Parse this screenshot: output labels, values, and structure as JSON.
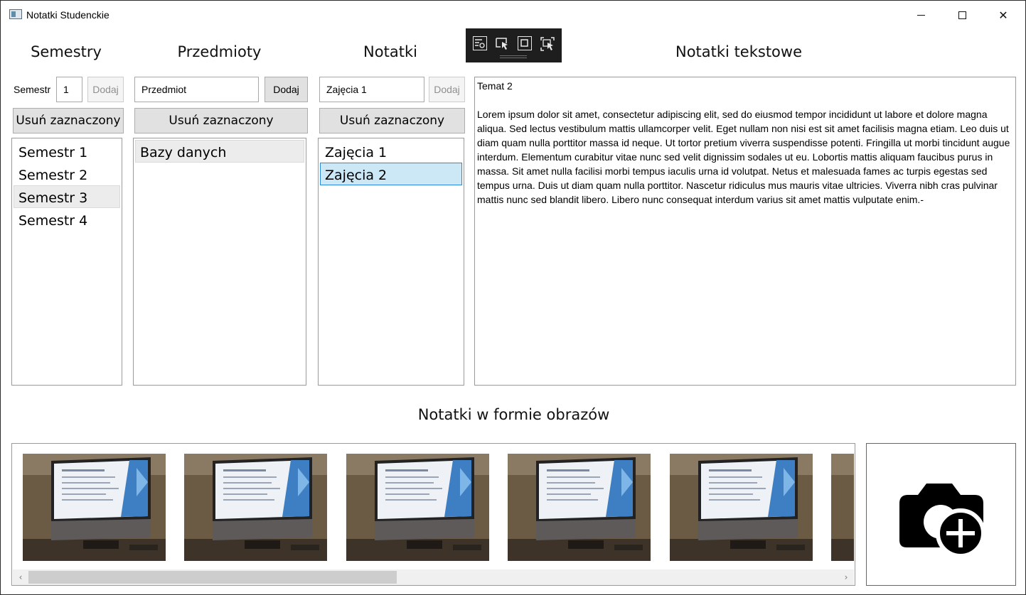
{
  "window": {
    "title": "Notatki Studenckie",
    "minimize_glyph": "",
    "close_glyph": "✕"
  },
  "semesters": {
    "heading": "Semestry",
    "input_label": "Semestr",
    "input_value": "1",
    "add_label": "Dodaj",
    "remove_label": "Usuń zaznaczony",
    "items": [
      "Semestr 1",
      "Semestr 2",
      "Semestr 3",
      "Semestr 4"
    ],
    "hovered_index": 2
  },
  "subjects": {
    "heading": "Przedmioty",
    "input_value": "Przedmiot",
    "add_label": "Dodaj",
    "remove_label": "Usuń zaznaczony",
    "items": [
      "Bazy danych"
    ],
    "hovered_index": 0
  },
  "notes": {
    "heading": "Notatki",
    "input_value": "Zajęcia 1",
    "add_label": "Dodaj",
    "remove_label": "Usuń zaznaczony",
    "items": [
      "Zajęcia 1",
      "Zajęcia 2"
    ],
    "selected_index": 1
  },
  "text_notes": {
    "heading": "Notatki tekstowe",
    "content": "Temat 2\n\nLorem ipsum dolor sit amet, consectetur adipiscing elit, sed do eiusmod tempor incididunt ut labore et dolore magna aliqua. Sed lectus vestibulum mattis ullamcorper velit. Eget nullam non nisi est sit amet facilisis magna etiam. Leo duis ut diam quam nulla porttitor massa id neque. Ut tortor pretium viverra suspendisse potenti. Fringilla ut morbi tincidunt augue interdum. Elementum curabitur vitae nunc sed velit dignissim sodales ut eu. Lobortis mattis aliquam faucibus purus in massa. Sit amet nulla facilisi morbi tempus iaculis urna id volutpat. Netus et malesuada fames ac turpis egestas sed tempus urna. Duis ut diam quam nulla porttitor. Nascetur ridiculus mus mauris vitae ultricies. Viverra nibh cras pulvinar mattis nunc sed blandit libero. Libero nunc consequat interdum varius sit amet mattis vulputate enim.-"
  },
  "images": {
    "heading": "Notatki w formie obrazów",
    "thumbnails": [
      "lecture-screen-photo",
      "lecture-screen-photo",
      "lecture-screen-photo",
      "lecture-screen-photo",
      "lecture-screen-photo",
      "lecture-screen-photo"
    ],
    "scroll_left_glyph": "‹",
    "scroll_right_glyph": "›",
    "add_icon": "camera-add-icon"
  },
  "debug_toolbar": {
    "icons": [
      "select-element-icon",
      "pointer-select-icon",
      "layout-adorner-icon",
      "track-focus-icon"
    ]
  },
  "colors": {
    "selection": "#cce8f7",
    "selection_border": "#2d8ad8",
    "toolbar_bg": "#1e1e1e"
  }
}
